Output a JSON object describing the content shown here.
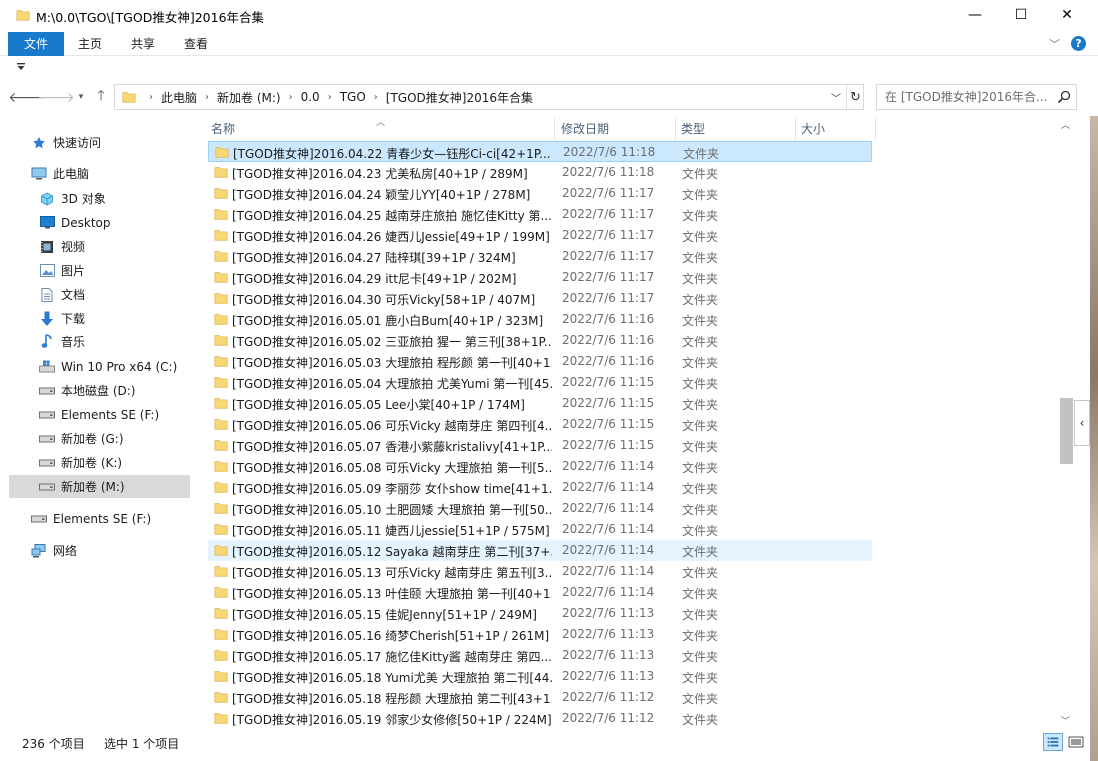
{
  "window": {
    "title": "M:\\0.0\\TGO\\[TGOD推女神]2016年合集",
    "minimize": "—",
    "maximize": "☐",
    "close": "✕"
  },
  "ribbon": {
    "tabs": [
      "文件",
      "主页",
      "共享",
      "查看"
    ]
  },
  "address": {
    "crumbs": [
      "此电脑",
      "新加卷 (M:)",
      "0.0",
      "TGO",
      "[TGOD推女神]2016年合集"
    ]
  },
  "search": {
    "placeholder": "在 [TGOD推女神]2016年合..."
  },
  "sidebar": {
    "items": [
      {
        "label": "快速访问",
        "icon": "star-icon"
      },
      {
        "label": "此电脑",
        "icon": "computer-icon"
      },
      {
        "label": "3D 对象",
        "icon": "3d-objects-icon"
      },
      {
        "label": "Desktop",
        "icon": "desktop-icon"
      },
      {
        "label": "视频",
        "icon": "video-icon"
      },
      {
        "label": "图片",
        "icon": "pictures-icon"
      },
      {
        "label": "文档",
        "icon": "documents-icon"
      },
      {
        "label": "下载",
        "icon": "download-icon"
      },
      {
        "label": "音乐",
        "icon": "music-icon"
      },
      {
        "label": "Win 10 Pro x64 (C:)",
        "icon": "windows-drive-icon"
      },
      {
        "label": "本地磁盘 (D:)",
        "icon": "drive-icon"
      },
      {
        "label": "Elements SE (F:)",
        "icon": "drive-icon"
      },
      {
        "label": "新加卷 (G:)",
        "icon": "drive-icon"
      },
      {
        "label": "新加卷 (K:)",
        "icon": "drive-icon"
      },
      {
        "label": "新加卷 (M:)",
        "icon": "drive-icon"
      },
      {
        "label": "Elements SE (F:)",
        "icon": "removable-drive-icon"
      },
      {
        "label": "网络",
        "icon": "network-icon"
      }
    ]
  },
  "columns": {
    "name": "名称",
    "date": "修改日期",
    "type": "类型",
    "size": "大小"
  },
  "files": [
    {
      "name": "[TGOD推女神]2016.04.22 青春少女—钰彤Ci-ci[42+1P...",
      "date": "2022/7/6 11:18",
      "type": "文件夹"
    },
    {
      "name": "[TGOD推女神]2016.04.23 尤美私房[40+1P / 289M]",
      "date": "2022/7/6 11:18",
      "type": "文件夹"
    },
    {
      "name": "[TGOD推女神]2016.04.24 颖莹儿YY[40+1P / 278M]",
      "date": "2022/7/6 11:17",
      "type": "文件夹"
    },
    {
      "name": "[TGOD推女神]2016.04.25 越南芽庄旅拍 施忆佳Kitty 第...",
      "date": "2022/7/6 11:17",
      "type": "文件夹"
    },
    {
      "name": "[TGOD推女神]2016.04.26 婕西儿Jessie[49+1P / 199M]",
      "date": "2022/7/6 11:17",
      "type": "文件夹"
    },
    {
      "name": "[TGOD推女神]2016.04.27 陆梓琪[39+1P / 324M]",
      "date": "2022/7/6 11:17",
      "type": "文件夹"
    },
    {
      "name": "[TGOD推女神]2016.04.29 itt尼卡[49+1P / 202M]",
      "date": "2022/7/6 11:17",
      "type": "文件夹"
    },
    {
      "name": "[TGOD推女神]2016.04.30 可乐Vicky[58+1P / 407M]",
      "date": "2022/7/6 11:17",
      "type": "文件夹"
    },
    {
      "name": "[TGOD推女神]2016.05.01 鹿小白Bum[40+1P / 323M]",
      "date": "2022/7/6 11:16",
      "type": "文件夹"
    },
    {
      "name": "[TGOD推女神]2016.05.02 三亚旅拍 猩一 第三刊[38+1P...",
      "date": "2022/7/6 11:16",
      "type": "文件夹"
    },
    {
      "name": "[TGOD推女神]2016.05.03 大理旅拍 程彤颜 第一刊[40+1...",
      "date": "2022/7/6 11:16",
      "type": "文件夹"
    },
    {
      "name": "[TGOD推女神]2016.05.04 大理旅拍 尤美Yumi 第一刊[45...",
      "date": "2022/7/6 11:15",
      "type": "文件夹"
    },
    {
      "name": "[TGOD推女神]2016.05.05 Lee小棠[40+1P / 174M]",
      "date": "2022/7/6 11:15",
      "type": "文件夹"
    },
    {
      "name": "[TGOD推女神]2016.05.06 可乐Vicky 越南芽庄 第四刊[4...",
      "date": "2022/7/6 11:15",
      "type": "文件夹"
    },
    {
      "name": "[TGOD推女神]2016.05.07 香港小紫藤kristalivy[41+1P...",
      "date": "2022/7/6 11:15",
      "type": "文件夹"
    },
    {
      "name": "[TGOD推女神]2016.05.08 可乐Vicky 大理旅拍 第一刊[5...",
      "date": "2022/7/6 11:14",
      "type": "文件夹"
    },
    {
      "name": "[TGOD推女神]2016.05.09 李丽莎 女仆show time[41+1...",
      "date": "2022/7/6 11:14",
      "type": "文件夹"
    },
    {
      "name": "[TGOD推女神]2016.05.10 土肥圆矮 大理旅拍 第一刊[50...",
      "date": "2022/7/6 11:14",
      "type": "文件夹"
    },
    {
      "name": "[TGOD推女神]2016.05.11 婕西儿jessie[51+1P / 575M]",
      "date": "2022/7/6 11:14",
      "type": "文件夹"
    },
    {
      "name": "[TGOD推女神]2016.05.12 Sayaka 越南芽庄 第二刊[37+...",
      "date": "2022/7/6 11:14",
      "type": "文件夹"
    },
    {
      "name": "[TGOD推女神]2016.05.13 可乐Vicky 越南芽庄 第五刊[3...",
      "date": "2022/7/6 11:14",
      "type": "文件夹"
    },
    {
      "name": "[TGOD推女神]2016.05.13 叶佳颐 大理旅拍 第一刊[40+1...",
      "date": "2022/7/6 11:14",
      "type": "文件夹"
    },
    {
      "name": "[TGOD推女神]2016.05.15 佳妮Jenny[51+1P / 249M]",
      "date": "2022/7/6 11:13",
      "type": "文件夹"
    },
    {
      "name": "[TGOD推女神]2016.05.16 绮梦Cherish[51+1P / 261M]",
      "date": "2022/7/6 11:13",
      "type": "文件夹"
    },
    {
      "name": "[TGOD推女神]2016.05.17 施忆佳Kitty酱 越南芽庄 第四...",
      "date": "2022/7/6 11:13",
      "type": "文件夹"
    },
    {
      "name": "[TGOD推女神]2016.05.18 Yumi尤美 大理旅拍 第二刊[44...",
      "date": "2022/7/6 11:13",
      "type": "文件夹"
    },
    {
      "name": "[TGOD推女神]2016.05.18 程彤颜 大理旅拍 第二刊[43+1...",
      "date": "2022/7/6 11:12",
      "type": "文件夹"
    },
    {
      "name": "[TGOD推女神]2016.05.19 邻家少女修修[50+1P / 224M]",
      "date": "2022/7/6 11:12",
      "type": "文件夹"
    }
  ],
  "status": {
    "item_count": "236 个项目",
    "selected": "选中 1 个项目"
  },
  "colors": {
    "accent": "#1979ca",
    "selected_row": "#cce8ff",
    "hover_row": "#e5f3ff",
    "folder": "#f8d775"
  }
}
